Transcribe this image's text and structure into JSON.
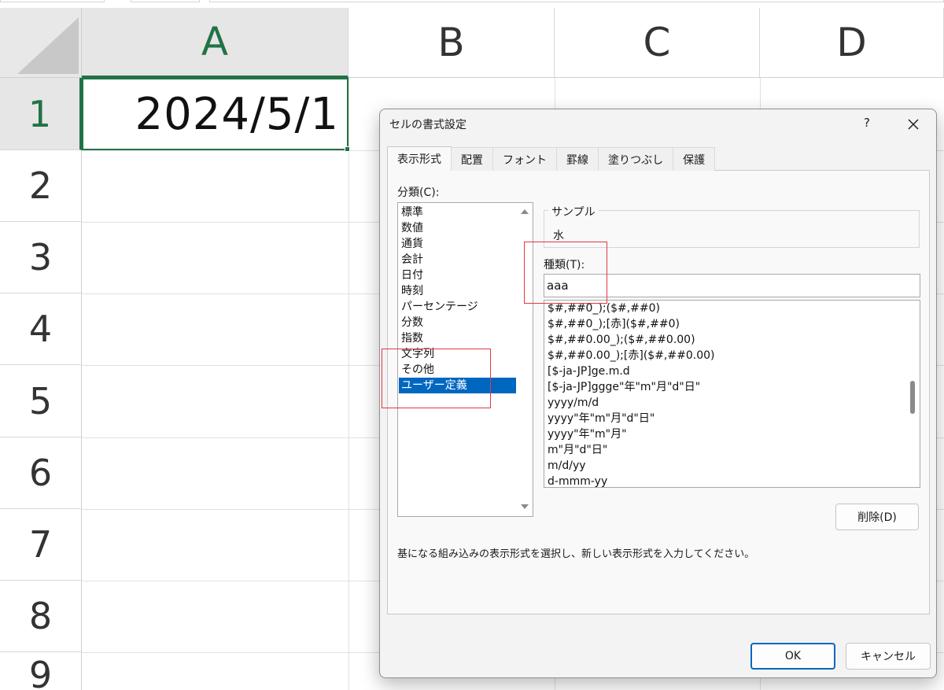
{
  "spreadsheet": {
    "columns": [
      "A",
      "B",
      "C",
      "D"
    ],
    "rows": [
      "1",
      "2",
      "3",
      "4",
      "5",
      "6",
      "7",
      "8",
      "9"
    ],
    "cell_a1": "2024/5/1",
    "colors": {
      "accent": "#217346",
      "header_selected_bg": "#e6e6e6"
    }
  },
  "dialog": {
    "title": "セルの書式設定",
    "help": "?",
    "tabs": [
      {
        "label": "表示形式"
      },
      {
        "label": "配置"
      },
      {
        "label": "フォント"
      },
      {
        "label": "罫線"
      },
      {
        "label": "塗りつぶし"
      },
      {
        "label": "保護"
      }
    ],
    "category_label": "分類(C):",
    "categories": [
      {
        "label": "標準"
      },
      {
        "label": "数値"
      },
      {
        "label": "通貨"
      },
      {
        "label": "会計"
      },
      {
        "label": "日付"
      },
      {
        "label": "時刻"
      },
      {
        "label": "パーセンテージ"
      },
      {
        "label": "分数"
      },
      {
        "label": "指数"
      },
      {
        "label": "文字列"
      },
      {
        "label": "その他"
      },
      {
        "label": "ユーザー定義"
      }
    ],
    "selected_category": "ユーザー定義",
    "sample_label": "サンプル",
    "sample_value": "水",
    "type_label": "種類(T):",
    "type_value": "aaa",
    "formats": [
      {
        "label": "$#,##0_);($#,##0)"
      },
      {
        "label": "$#,##0_);[赤]($#,##0)"
      },
      {
        "label": "$#,##0.00_);($#,##0.00)"
      },
      {
        "label": "$#,##0.00_);[赤]($#,##0.00)"
      },
      {
        "label": "[$-ja-JP]ge.m.d"
      },
      {
        "label": "[$-ja-JP]ggge\"年\"m\"月\"d\"日\""
      },
      {
        "label": "yyyy/m/d"
      },
      {
        "label": "yyyy\"年\"m\"月\"d\"日\""
      },
      {
        "label": "yyyy\"年\"m\"月\""
      },
      {
        "label": "m\"月\"d\"日\""
      },
      {
        "label": "m/d/yy"
      },
      {
        "label": "d-mmm-yy"
      }
    ],
    "delete_label": "削除(D)",
    "description": "基になる組み込みの表示形式を選択し、新しい表示形式を入力してください。",
    "ok_label": "OK",
    "cancel_label": "キャンセル",
    "colors": {
      "selection": "#0067c0",
      "highlight_box": "#e0393e"
    }
  }
}
